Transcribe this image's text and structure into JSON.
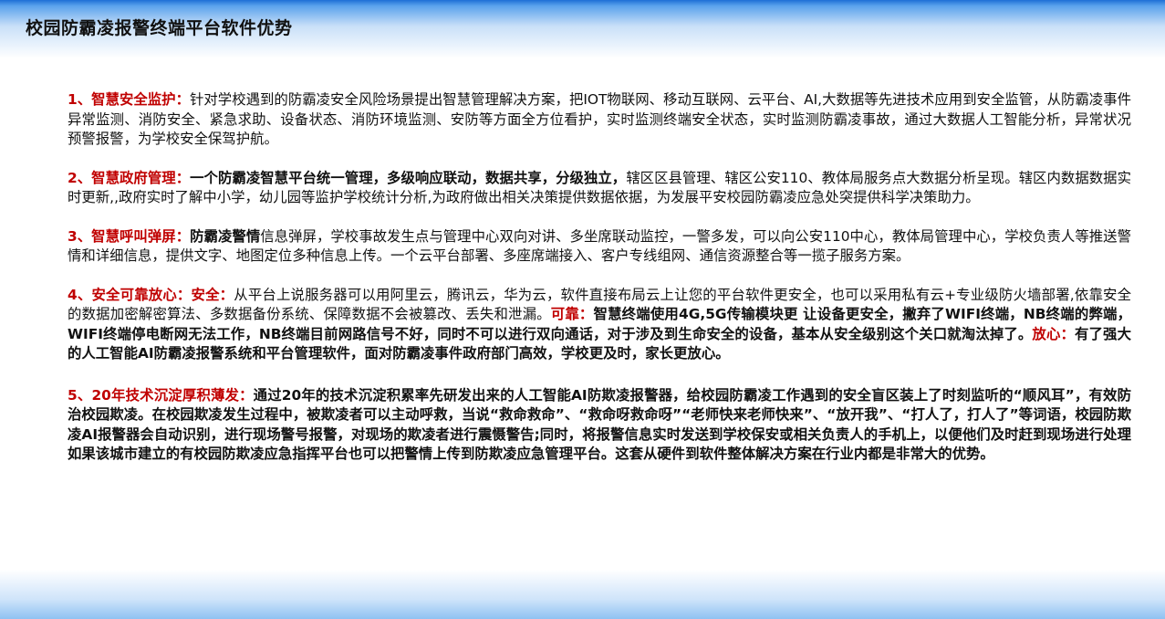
{
  "title": "校园防霸凌报警终端平台软件优势",
  "p1": {
    "head": "1、智慧安全监护：",
    "body": "针对学校遇到的防霸凌安全风险场景提出智慧管理解决方案，把IOT物联网、移动互联网、云平台、AI,大数据等先进技术应用到安全监管，从防霸凌事件异常监测、消防安全、紧急求助、设备状态、消防环境监测、安防等方面全方位看护，实时监测终端安全状态，实时监测防霸凌事故，通过大数据人工智能分析，异常状况预警报警，为学校安全保驾护航。"
  },
  "p2": {
    "head": "2、智慧政府管理：",
    "bold": "一个防霸凌智慧平台统一管理，多级响应联动，数据共享，分级独立，",
    "body": "辖区区县管理、辖区公安110、教体局服务点大数据分析呈现。辖区内数据数据实时更新,,政府实时了解中小学，幼儿园等监护学校统计分析,为政府做出相关决策提供数据依据，为发展平安校园防霸凌应急处突提供科学决策助力。"
  },
  "p3": {
    "head": "3、智慧呼叫弹屏：",
    "bold": "防霸凌警情",
    "body": "信息弹屏，学校事故发生点与管理中心双向对讲、多坐席联动监控，一警多发，可以向公安110中心，教体局管理中心，学校负责人等推送警情和详细信息，提供文字、地图定位多种信息上传。一个云平台部署、多座席端接入、客户专线组网、通信资源整合等一揽子服务方案。"
  },
  "p4": {
    "head": "4、安全可靠放心：安全：",
    "body1": "从平台上说服务器可以用阿里云，腾讯云，华为云，软件直接布局云上让您的平台软件更安全，也可以采用私有云+专业级防火墙部署,依靠安全的数据加密解密算法、多数据备份系统、保障数据不会被篡改、丢失和泄漏。",
    "head2": "可靠：",
    "bold2": "智慧终端使用4G,5G传输模块更 让设备更安全，撇弃了WIFI终端，NB终端的弊端，WIFI终端停电断网无法工作，NB终端目前网路信号不好，同时不可以进行双向通话，对于涉及到生命安全的设备，基本从安全级别这个关口就淘汰掉了。",
    "head3": "放心：",
    "bold3": "有了强大的人工智能AI防霸凌报警系统和平台管理软件，面对防霸凌事件政府部门高效，学校更及时，家长更放心。"
  },
  "p5": {
    "head": "5、20年技术沉淀厚积薄发：",
    "bold": "通过20年的技术沉淀积累率先研发出来的人工智能AI防欺凌报警器，给校园防霸凌工作遇到的安全盲区装上了时刻监听的“顺风耳”，有效防治校园欺凌。在校园欺凌发生过程中，被欺凌者可以主动呼救，当说“救命救命”、“救命呀救命呀”“老师快来老师快来”、“放开我”、“打人了，打人了”等词语，校园防欺凌AI报警器会自动识别，进行现场警号报警，对现场的欺凌者进行震慑警告;同时，将报警信息实时发送到学校保安或相关负责人的手机上，以便他们及时赶到现场进行处理如果该城市建立的有校园防欺凌应急指挥平台也可以把警情上传到防欺凌应急管理平台。这套从硬件到软件整体解决方案在行业内都是非常大的优势。"
  }
}
